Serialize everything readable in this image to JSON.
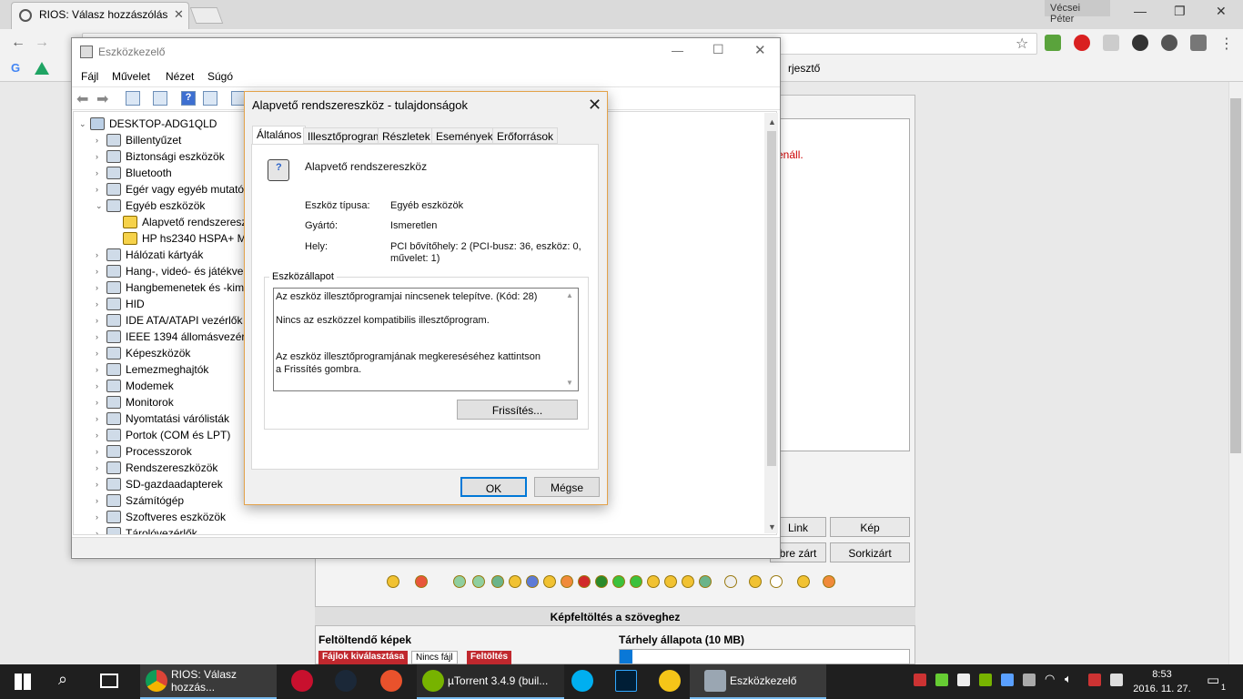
{
  "browser": {
    "tab_title": "RIOS: Válasz hozzászólás",
    "profile": "Vécsei Péter",
    "bookmark_partial": "rjesztő",
    "text_red": "enáll."
  },
  "forum": {
    "buttons": [
      "Link",
      "Kép",
      "bre zárt",
      "Sorkizárt"
    ],
    "upload_header": "Képfeltöltés a szöveghez",
    "upload_label": "Feltöltendő képek",
    "storage_label": "Tárhely állapota (10 MB)",
    "choose_files": "Fájlok kiválasztása",
    "no_file": "Nincs fájl",
    "upload_btn": "Feltöltés"
  },
  "device_manager": {
    "title": "Eszközkezelő",
    "menu": [
      "Fájl",
      "Művelet",
      "Nézet",
      "Súgó"
    ],
    "root": "DESKTOP-ADG1QLD",
    "tree": [
      {
        "label": "Billentyűzet",
        "level": 1,
        "exp": "›"
      },
      {
        "label": "Biztonsági eszközök",
        "level": 1,
        "exp": "›"
      },
      {
        "label": "Bluetooth",
        "level": 1,
        "exp": "›"
      },
      {
        "label": "Egér vagy egyéb mutató",
        "level": 1,
        "exp": "›"
      },
      {
        "label": "Egyéb eszközök",
        "level": 1,
        "exp": "⌄"
      },
      {
        "label": "Alapvető rendszeresz",
        "level": 2,
        "exp": "",
        "warn": true
      },
      {
        "label": "HP hs2340 HSPA+ M",
        "level": 2,
        "exp": "",
        "warn": true
      },
      {
        "label": "Hálózati kártyák",
        "level": 1,
        "exp": "›"
      },
      {
        "label": "Hang-, videó- és játékve",
        "level": 1,
        "exp": "›"
      },
      {
        "label": "Hangbemenetek és -kim",
        "level": 1,
        "exp": "›"
      },
      {
        "label": "HID",
        "level": 1,
        "exp": "›"
      },
      {
        "label": "IDE ATA/ATAPI vezérlők",
        "level": 1,
        "exp": "›"
      },
      {
        "label": "IEEE 1394 állomásvezérl",
        "level": 1,
        "exp": "›"
      },
      {
        "label": "Képeszközök",
        "level": 1,
        "exp": "›"
      },
      {
        "label": "Lemezmeghajtók",
        "level": 1,
        "exp": "›"
      },
      {
        "label": "Modemek",
        "level": 1,
        "exp": "›"
      },
      {
        "label": "Monitorok",
        "level": 1,
        "exp": "›"
      },
      {
        "label": "Nyomtatási várólisták",
        "level": 1,
        "exp": "›"
      },
      {
        "label": "Portok (COM és LPT)",
        "level": 1,
        "exp": "›"
      },
      {
        "label": "Processzorok",
        "level": 1,
        "exp": "›"
      },
      {
        "label": "Rendszereszközök",
        "level": 1,
        "exp": "›"
      },
      {
        "label": "SD-gazdaadapterek",
        "level": 1,
        "exp": "›"
      },
      {
        "label": "Számítógép",
        "level": 1,
        "exp": "›"
      },
      {
        "label": "Szoftveres eszközök",
        "level": 1,
        "exp": "›"
      },
      {
        "label": "Tárolóvezérlők",
        "level": 1,
        "exp": "›"
      }
    ]
  },
  "properties": {
    "title": "Alapvető rendszereszköz - tulajdonságok",
    "tabs": [
      "Általános",
      "Illesztőprogram",
      "Részletek",
      "Események",
      "Erőforrások"
    ],
    "device_name": "Alapvető rendszereszköz",
    "type_label": "Eszköz típusa:",
    "type_value": "Egyéb eszközök",
    "maker_label": "Gyártó:",
    "maker_value": "Ismeretlen",
    "location_label": "Hely:",
    "location_value_1": "PCI bővítőhely: 2 (PCI-busz: 36, eszköz: 0,",
    "location_value_2": "művelet: 1)",
    "status_legend": "Eszközállapot",
    "status_1": "Az eszköz illesztőprogramjai nincsenek telepítve. (Kód: 28)",
    "status_2": "Nincs az eszközzel kompatibilis illesztőprogram.",
    "status_3": "Az eszköz illesztőprogramjának megkereséséhez kattintson a Frissítés gombra.",
    "refresh": "Frissítés...",
    "ok": "OK",
    "cancel": "Mégse"
  },
  "taskbar": {
    "apps": [
      {
        "label": "RIOS: Válasz hozzás...",
        "color": "#f4b400"
      },
      {
        "label": "µTorrent 3.4.9  (buil...",
        "color": "#77b300"
      },
      {
        "label": "Eszközkezelő",
        "color": "#9aa6b2"
      }
    ],
    "time": "8:53",
    "date": "2016. 11. 27.",
    "notif_count": "1"
  }
}
